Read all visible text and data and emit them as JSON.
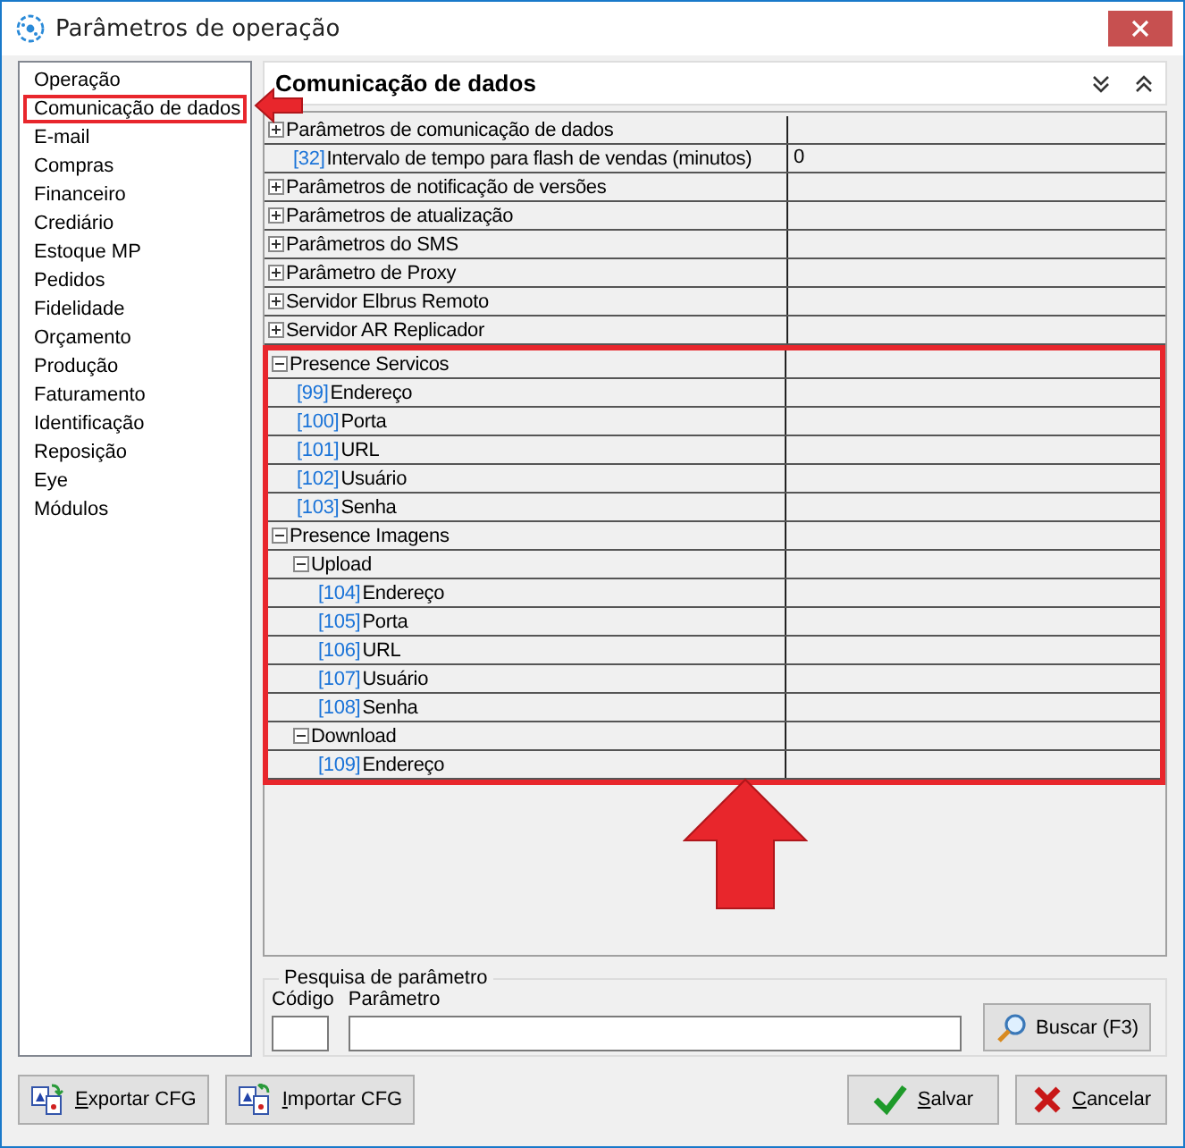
{
  "window": {
    "title": "Parâmetros de operação"
  },
  "sidebar": {
    "items": [
      {
        "label": "Operação",
        "highlighted": false
      },
      {
        "label": "Comunicação de dados",
        "highlighted": true
      },
      {
        "label": "E-mail",
        "highlighted": false
      },
      {
        "label": "Compras",
        "highlighted": false
      },
      {
        "label": "Financeiro",
        "highlighted": false
      },
      {
        "label": "Crediário",
        "highlighted": false
      },
      {
        "label": "Estoque MP",
        "highlighted": false
      },
      {
        "label": "Pedidos",
        "highlighted": false
      },
      {
        "label": "Fidelidade",
        "highlighted": false
      },
      {
        "label": "Orçamento",
        "highlighted": false
      },
      {
        "label": "Produção",
        "highlighted": false
      },
      {
        "label": "Faturamento",
        "highlighted": false
      },
      {
        "label": "Identificação",
        "highlighted": false
      },
      {
        "label": "Reposição",
        "highlighted": false
      },
      {
        "label": "Eye",
        "highlighted": false
      },
      {
        "label": "Módulos",
        "highlighted": false
      }
    ]
  },
  "panel": {
    "title": "Comunicação de dados",
    "tree": [
      {
        "kind": "group",
        "label": "Parâmetros de comunicação de dados",
        "expanded": false,
        "highlighted": false,
        "children": [
          {
            "kind": "param",
            "code": "[32]",
            "label": "Intervalo de tempo para flash de vendas (minutos)",
            "value": "0"
          }
        ]
      },
      {
        "kind": "group",
        "label": "Parâmetros de notificação de versões",
        "expanded": false,
        "highlighted": false
      },
      {
        "kind": "group",
        "label": "Parâmetros de atualização",
        "expanded": false,
        "highlighted": false
      },
      {
        "kind": "group",
        "label": "Parâmetros do SMS",
        "expanded": false,
        "highlighted": false
      },
      {
        "kind": "group",
        "label": "Parâmetro de Proxy",
        "expanded": false,
        "highlighted": false
      },
      {
        "kind": "group",
        "label": "Servidor Elbrus Remoto",
        "expanded": false,
        "highlighted": false
      },
      {
        "kind": "group",
        "label": "Servidor AR Replicador",
        "expanded": false,
        "highlighted": false
      },
      {
        "kind": "group",
        "label": "Presence Servicos",
        "expanded": true,
        "highlighted": true,
        "children": [
          {
            "kind": "param",
            "code": "[99]",
            "label": "Endereço"
          },
          {
            "kind": "param",
            "code": "[100]",
            "label": "Porta"
          },
          {
            "kind": "param",
            "code": "[101]",
            "label": "URL"
          },
          {
            "kind": "param",
            "code": "[102]",
            "label": "Usuário"
          },
          {
            "kind": "param",
            "code": "[103]",
            "label": "Senha"
          }
        ]
      },
      {
        "kind": "group",
        "label": "Presence Imagens",
        "expanded": true,
        "highlighted": true,
        "children": [
          {
            "kind": "group",
            "label": "Upload",
            "expanded": true,
            "children": [
              {
                "kind": "param",
                "code": "[104]",
                "label": "Endereço"
              },
              {
                "kind": "param",
                "code": "[105]",
                "label": "Porta"
              },
              {
                "kind": "param",
                "code": "[106]",
                "label": "URL"
              },
              {
                "kind": "param",
                "code": "[107]",
                "label": "Usuário"
              },
              {
                "kind": "param",
                "code": "[108]",
                "label": "Senha"
              }
            ]
          },
          {
            "kind": "group",
            "label": "Download",
            "expanded": true,
            "children": [
              {
                "kind": "param",
                "code": "[109]",
                "label": "Endereço"
              }
            ]
          }
        ]
      }
    ]
  },
  "search": {
    "title": "Pesquisa de parâmetro",
    "code_label": "Código",
    "param_label": "Parâmetro",
    "button": "Buscar (F3)"
  },
  "footer": {
    "left": [
      "Exportar CFG",
      "Importar CFG"
    ],
    "right": [
      "Salvar",
      "Cancelar"
    ]
  }
}
